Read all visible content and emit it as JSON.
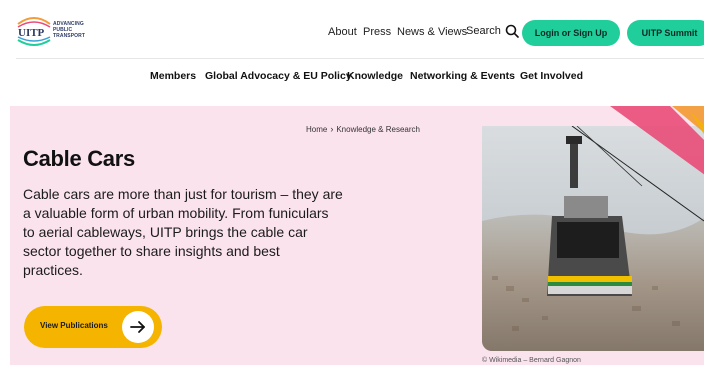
{
  "header": {
    "logo": {
      "wordmark": "UITP",
      "tagline": [
        "ADVANCING",
        "PUBLIC",
        "TRANSPORT"
      ]
    },
    "topnav": [
      "About",
      "Press",
      "News & Views"
    ],
    "search_label": "Search",
    "login_label": "Login or Sign Up",
    "summit_label": "UITP Summit"
  },
  "mainnav": [
    "Members",
    "Global Advocacy & EU Policy",
    "Knowledge",
    "Networking & Events",
    "Get Involved"
  ],
  "hero": {
    "breadcrumb": {
      "home": "Home",
      "current": "Knowledge & Research"
    },
    "title": "Cable Cars",
    "description": "Cable cars are more than just for tourism – they are a valuable form of urban mobility. From funiculars to aerial cableways, UITP brings the cable car sector together to share insights and best practices.",
    "cta_label": "View Publications",
    "photo_credit": "© Wikimedia – Bernard Gagnon"
  },
  "colors": {
    "accent_green": "#1fce9a",
    "hero_bg": "#fbe3ee",
    "cta_yellow": "#f4b400",
    "logo_navy": "#2f3b66"
  }
}
